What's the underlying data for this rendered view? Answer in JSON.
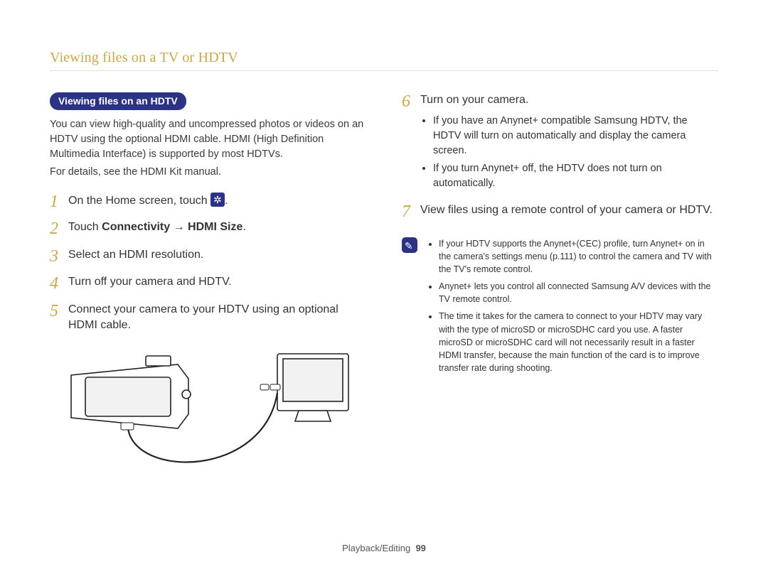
{
  "header": {
    "title": "Viewing files on a TV or HDTV"
  },
  "section": {
    "pill": "Viewing files on an HDTV"
  },
  "intro": {
    "p1": "You can view high-quality and uncompressed photos or videos on an HDTV using the optional HDMI cable. HDMI (High Definition Multimedia Interface) is supported by most HDTVs.",
    "p2": "For details, see the HDMI Kit manual."
  },
  "steps": {
    "s1": {
      "num": "1",
      "pre": "On the Home screen, touch",
      "post": "."
    },
    "s2": {
      "num": "2",
      "pre": "Touch ",
      "bold": "Connectivity → HDMI Size",
      "post": "."
    },
    "s3": {
      "num": "3",
      "text": "Select an HDMI resolution."
    },
    "s4": {
      "num": "4",
      "text": "Turn off your camera and HDTV."
    },
    "s5": {
      "num": "5",
      "text": "Connect your camera to your HDTV using an optional HDMI cable."
    },
    "s6": {
      "num": "6",
      "text": "Turn on your camera.",
      "bullets": [
        "If you have an Anynet+ compatible Samsung HDTV, the HDTV will turn on automatically and display the camera screen.",
        "If you turn Anynet+ off, the HDTV does not turn on automatically."
      ]
    },
    "s7": {
      "num": "7",
      "text": "View files using a remote control of your camera or HDTV."
    }
  },
  "notes": [
    "If your HDTV supports the Anynet+(CEC) profile, turn Anynet+ on in the camera's settings menu (p.111) to control the camera and TV with the TV's remote control.",
    "Anynet+ lets you control all connected Samsung A/V devices with the TV remote control.",
    "The time it takes for the camera to connect to your HDTV may vary with the type of microSD or microSDHC card you use. A faster microSD or microSDHC card will not necessarily result in a faster HDMI transfer, because the main function of the card is to improve transfer rate during shooting."
  ],
  "footer": {
    "section": "Playback/Editing",
    "page": "99"
  }
}
